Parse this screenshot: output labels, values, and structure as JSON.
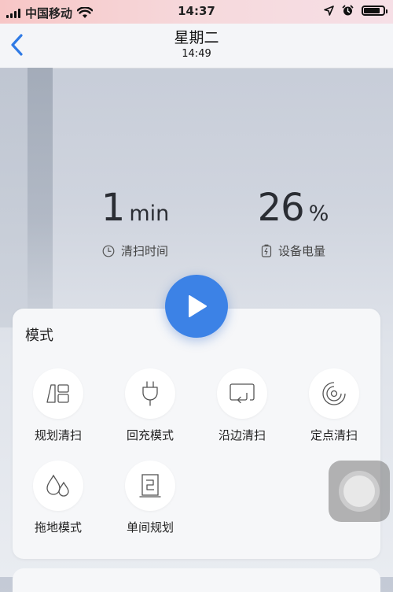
{
  "status_bar": {
    "carrier": "中国移动",
    "time": "14:37",
    "battery_level": 0.85
  },
  "nav": {
    "title": "星期二",
    "subtitle": "14:49"
  },
  "stats": {
    "clean_time": {
      "value": "1",
      "unit": "min",
      "label": "清扫时间"
    },
    "battery": {
      "value": "26",
      "unit": "%",
      "label": "设备电量"
    }
  },
  "mode": {
    "title": "模式",
    "items": [
      {
        "label": "规划清扫",
        "icon": "plan-clean-icon"
      },
      {
        "label": "回充模式",
        "icon": "plug-icon"
      },
      {
        "label": "沿边清扫",
        "icon": "edge-clean-icon"
      },
      {
        "label": "定点清扫",
        "icon": "spot-clean-icon"
      },
      {
        "label": "拖地模式",
        "icon": "mop-drops-icon"
      },
      {
        "label": "单间规划",
        "icon": "room-plan-icon"
      }
    ]
  },
  "colors": {
    "accent": "#3c82e6",
    "card": "#f6f7f9",
    "icon_stroke": "#555555"
  }
}
